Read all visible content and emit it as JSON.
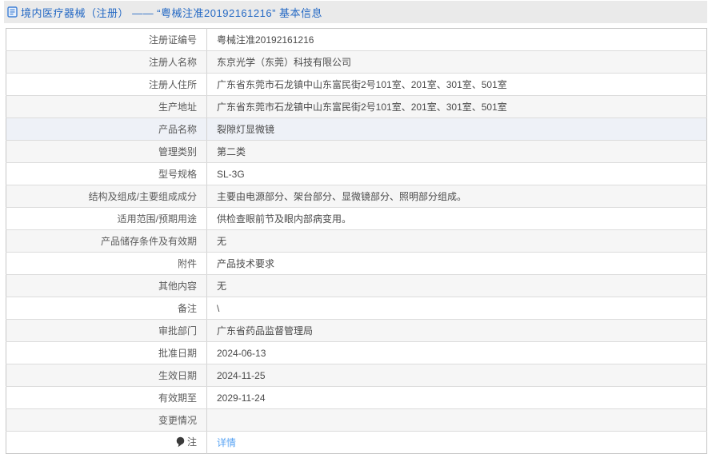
{
  "header": {
    "title": "境内医疗器械（注册） —— “粤械注准20192161216” 基本信息",
    "icon": "document-icon"
  },
  "colors": {
    "header_bg": "#eaeaea",
    "title_blue": "#2368c4",
    "link_blue": "#58a3f3",
    "stripe_gray": "#f6f6f6",
    "highlight_row": "#eef1f7",
    "border": "#c6c6c6"
  },
  "table": {
    "rows": [
      {
        "label": "注册证编号",
        "value": "粤械注准20192161216"
      },
      {
        "label": "注册人名称",
        "value": "东京光学（东莞）科技有限公司"
      },
      {
        "label": "注册人住所",
        "value": "广东省东莞市石龙镇中山东富民街2号101室、201室、301室、501室"
      },
      {
        "label": "生产地址",
        "value": "广东省东莞市石龙镇中山东富民街2号101室、201室、301室、501室"
      },
      {
        "label": "产品名称",
        "value": "裂隙灯显微镜",
        "highlighted": true
      },
      {
        "label": "管理类别",
        "value": "第二类"
      },
      {
        "label": "型号规格",
        "value": "SL-3G"
      },
      {
        "label": "结构及组成/主要组成成分",
        "value": "主要由电源部分、架台部分、显微镜部分、照明部分组成。"
      },
      {
        "label": "适用范围/预期用途",
        "value": "供检查眼前节及眼内部病变用。"
      },
      {
        "label": "产品储存条件及有效期",
        "value": "无"
      },
      {
        "label": "附件",
        "value": "产品技术要求"
      },
      {
        "label": "其他内容",
        "value": "无"
      },
      {
        "label": "备注",
        "value": "\\"
      },
      {
        "label": "审批部门",
        "value": "广东省药品监督管理局"
      },
      {
        "label": "批准日期",
        "value": "2024-06-13"
      },
      {
        "label": "生效日期",
        "value": "2024-11-25"
      },
      {
        "label": "有效期至",
        "value": "2029-11-24"
      },
      {
        "label": "变更情况",
        "value": ""
      },
      {
        "label": "注",
        "value": "详情",
        "label_icon": "balloon-icon",
        "value_is_link": true
      }
    ]
  }
}
